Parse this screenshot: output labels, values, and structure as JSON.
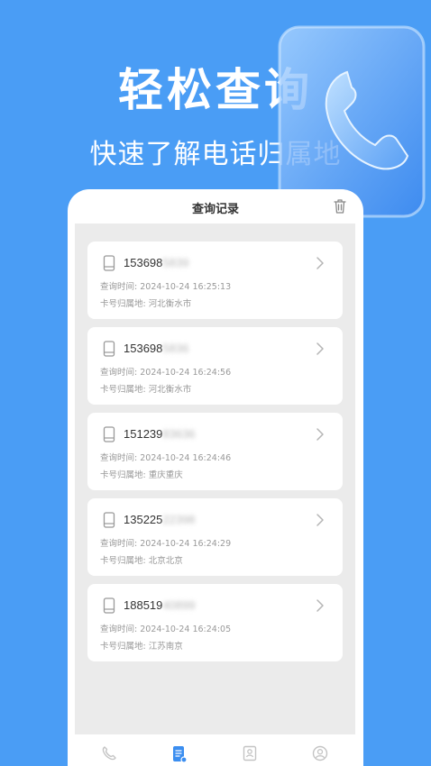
{
  "promo": {
    "title": "轻松查询",
    "subtitle": "快速了解电话归属地"
  },
  "header": {
    "title": "查询记录"
  },
  "records": [
    {
      "number_visible": "153698",
      "number_blurred": "5839",
      "time_label": "查询时间: ",
      "time": "2024-10-24 16:25:13",
      "loc_label": "卡号归属地: ",
      "location": "河北衡水市"
    },
    {
      "number_visible": "153698",
      "number_blurred": "5836",
      "time_label": "查询时间: ",
      "time": "2024-10-24 16:24:56",
      "loc_label": "卡号归属地: ",
      "location": "河北衡水市"
    },
    {
      "number_visible": "151239",
      "number_blurred": "83636",
      "time_label": "查询时间: ",
      "time": "2024-10-24 16:24:46",
      "loc_label": "卡号归属地: ",
      "location": "重庆重庆"
    },
    {
      "number_visible": "135225",
      "number_blurred": "22398",
      "time_label": "查询时间: ",
      "time": "2024-10-24 16:24:29",
      "loc_label": "卡号归属地: ",
      "location": "北京北京"
    },
    {
      "number_visible": "188519",
      "number_blurred": "40899",
      "time_label": "查询时间: ",
      "time": "2024-10-24 16:24:05",
      "loc_label": "卡号归属地: ",
      "location": "江苏南京"
    }
  ],
  "tabs": [
    {
      "icon": "phone-icon",
      "active": false
    },
    {
      "icon": "document-icon",
      "active": true
    },
    {
      "icon": "contact-book-icon",
      "active": false
    },
    {
      "icon": "user-icon",
      "active": false
    }
  ],
  "colors": {
    "background": "#4a9df5",
    "active_tab": "#3b8ef0",
    "inactive_tab": "#c4c4c4"
  }
}
